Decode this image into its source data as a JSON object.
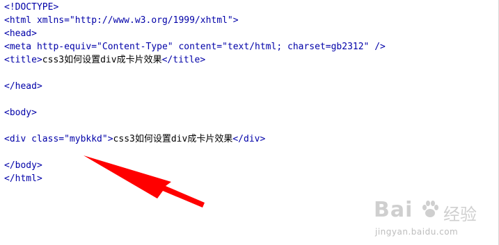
{
  "code_lines": [
    {
      "id": "l1",
      "parts": [
        {
          "t": "tag",
          "s": "<!DOCTYPE>"
        }
      ]
    },
    {
      "id": "l2",
      "parts": [
        {
          "t": "tag",
          "s": "<html xmlns=\"http://www.w3.org/1999/xhtml\">"
        }
      ]
    },
    {
      "id": "l3",
      "parts": [
        {
          "t": "tag",
          "s": "<head>"
        }
      ]
    },
    {
      "id": "l4",
      "parts": [
        {
          "t": "tag",
          "s": "<meta http-equiv=\"Content-Type\" content=\"text/html; charset=gb2312\" />"
        }
      ]
    },
    {
      "id": "l5",
      "parts": [
        {
          "t": "tag",
          "s": "<title>"
        },
        {
          "t": "text",
          "s": "css3如何设置div成卡片效果"
        },
        {
          "t": "tag",
          "s": "</title>"
        }
      ]
    },
    {
      "id": "l6",
      "parts": []
    },
    {
      "id": "l7",
      "parts": [
        {
          "t": "tag",
          "s": "</head>"
        }
      ]
    },
    {
      "id": "l8",
      "parts": []
    },
    {
      "id": "l9",
      "parts": [
        {
          "t": "tag",
          "s": "<body>"
        }
      ]
    },
    {
      "id": "l10",
      "parts": []
    },
    {
      "id": "l11",
      "parts": [
        {
          "t": "tag",
          "s": "<div class=\"mybkkd\">"
        },
        {
          "t": "text",
          "s": "css3如何设置div成卡片效果"
        },
        {
          "t": "tag",
          "s": "</div>"
        }
      ]
    },
    {
      "id": "l12",
      "parts": []
    },
    {
      "id": "l13",
      "parts": [
        {
          "t": "tag",
          "s": "</body>"
        }
      ]
    },
    {
      "id": "l14",
      "parts": [
        {
          "t": "tag",
          "s": "</html>"
        }
      ]
    }
  ],
  "watermark": {
    "logo_text": "Bai",
    "logo_suffix": "经验",
    "url": "jingyan.baidu.com",
    "icon": "baidu-paw-icon"
  },
  "colors": {
    "tag": "#0000a8",
    "text": "#000000",
    "arrow": "#ff0000",
    "watermark": "#cfcfcf"
  }
}
